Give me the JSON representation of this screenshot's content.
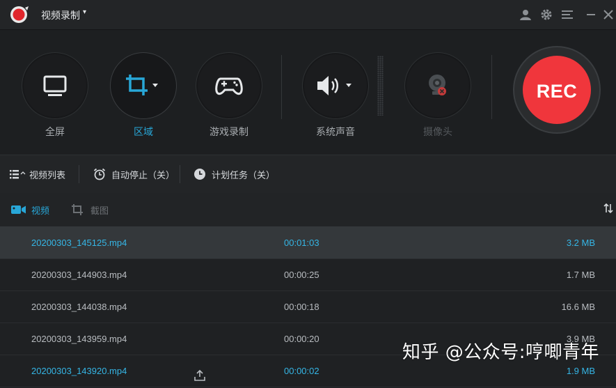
{
  "app": {
    "title": "视频录制",
    "caret": "▾"
  },
  "toolbar": {
    "tools": [
      {
        "label": "全屏",
        "icon": "monitor-icon",
        "state": "normal"
      },
      {
        "label": "区域",
        "icon": "crop-icon",
        "state": "active"
      },
      {
        "label": "游戏录制",
        "icon": "gamepad-icon",
        "state": "normal"
      },
      {
        "label": "系统声音",
        "icon": "speaker-icon",
        "state": "normal"
      },
      {
        "label": "摄像头",
        "icon": "webcam-icon",
        "state": "disabled"
      }
    ],
    "rec_label": "REC"
  },
  "options": {
    "video_list": "视频列表",
    "auto_stop": "自动停止（关）",
    "schedule": "计划任务（关）"
  },
  "tabs": {
    "video": "视频",
    "screenshot": "截图"
  },
  "files": [
    {
      "name": "20200303_145125.mp4",
      "duration": "00:01:03",
      "size": "3.2 MB",
      "selected": true
    },
    {
      "name": "20200303_144903.mp4",
      "duration": "00:00:25",
      "size": "1.7 MB",
      "selected": false
    },
    {
      "name": "20200303_144038.mp4",
      "duration": "00:00:18",
      "size": "16.6 MB",
      "selected": false
    },
    {
      "name": "20200303_143959.mp4",
      "duration": "00:00:20",
      "size": "3.9 MB",
      "selected": false
    },
    {
      "name": "20200303_143920.mp4",
      "duration": "00:00:02",
      "size": "1.9 MB",
      "selected": false,
      "highlight": true
    }
  ],
  "watermark": "知乎 @公众号:哼唧青年",
  "colors": {
    "accent": "#28a7d8",
    "rec_red": "#f0363c",
    "background": "#1f2123"
  }
}
